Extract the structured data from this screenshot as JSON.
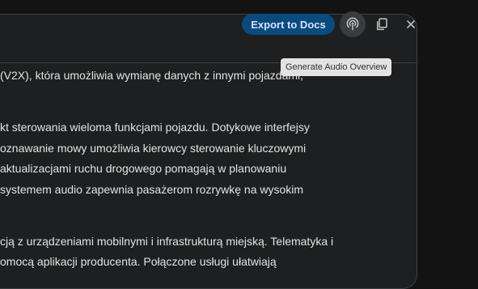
{
  "header": {
    "export_label": "Export to Docs",
    "tooltip": "Generate Audio Overview"
  },
  "icons": {
    "audio": "podcast-icon",
    "copy": "copy-icon",
    "close": "close-icon"
  },
  "content": {
    "lines": [
      "(V2X), która umożliwia wymianę danych z innymi pojazdami,",
      "kt sterowania wieloma funkcjami pojazdu. Dotykowe interfejsy",
      "oznawanie mowy umożliwia kierowcy sterowanie kluczowymi",
      "aktualizacjami ruchu drogowego pomagają w planowaniu",
      " systemem audio zapewnia pasażerom rozrywkę na wysokim",
      "cją z urządzeniami mobilnymi i infrastrukturą miejską. Telematyka i",
      "omocą aplikacji producenta. Połączone usługi ułatwiają"
    ]
  },
  "colors": {
    "background": "#131314",
    "panel": "#1e1f20",
    "export_button": "#0b4a7d",
    "export_text": "#d3e3fd",
    "text": "#e3e3e3",
    "tooltip_bg": "#e3e3e3"
  }
}
